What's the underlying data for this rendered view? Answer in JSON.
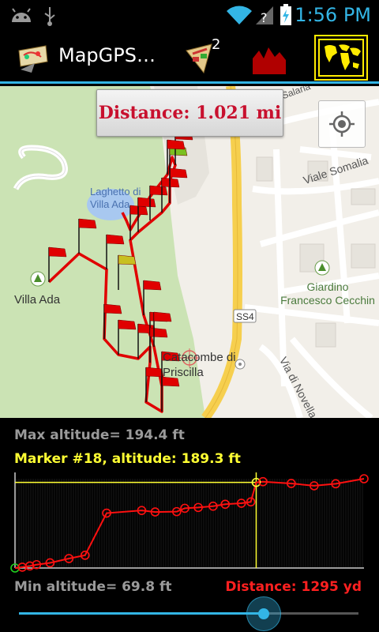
{
  "status_bar": {
    "time": "1:56 PM"
  },
  "action_bar": {
    "title": "MapGPS…",
    "waypoints_badge": "2",
    "app_icon": "mapgps-app-icon",
    "buttons": [
      "markers-icon",
      "altitude-profile-icon",
      "world-map-icon"
    ]
  },
  "map": {
    "distance": "Distance: 1.021 mi",
    "labels": {
      "laghetto": "Laghetto di Villa Ada",
      "villa_ada": "Villa Ada",
      "viale_somalia": "Viale Somalia",
      "giardino": "Giardino Francesco Cecchin",
      "ss4": "SS4",
      "catacombe": "Catacombe di Priscilla",
      "via_di_novella": "Via di Novella",
      "salaria": "Salaria"
    }
  },
  "profile": {
    "max_altitude": "Max altitude= 194.4 ft",
    "marker": "Marker #18, altitude: 189.3 ft",
    "min_altitude": "Min altitude= 69.8 ft",
    "distance": "Distance: 1295 yd",
    "slider_position": 0.72
  },
  "chart_data": {
    "type": "line",
    "title": "",
    "xlabel": "",
    "ylabel": "",
    "x_range": [
      0,
      1295
    ],
    "ylim": [
      69.8,
      194.4
    ],
    "series": [
      {
        "x": [
          0,
          27,
          55,
          80,
          130,
          200,
          260,
          340,
          470,
          520,
          600,
          630,
          680,
          735,
          780,
          840,
          875,
          895,
          920,
          1025,
          1110,
          1190,
          1295
        ],
        "y": [
          69.8,
          71,
          72.6,
          74.5,
          77,
          83,
          87.6,
          146.4,
          150.1,
          148,
          148.5,
          153.2,
          154.3,
          156.1,
          158.8,
          160.2,
          162.1,
          189.3,
          190.3,
          187.8,
          184.6,
          187.4,
          194.4
        ]
      }
    ],
    "selected_marker": {
      "index": 17,
      "x": 895,
      "y": 189.3
    },
    "grid": false
  }
}
